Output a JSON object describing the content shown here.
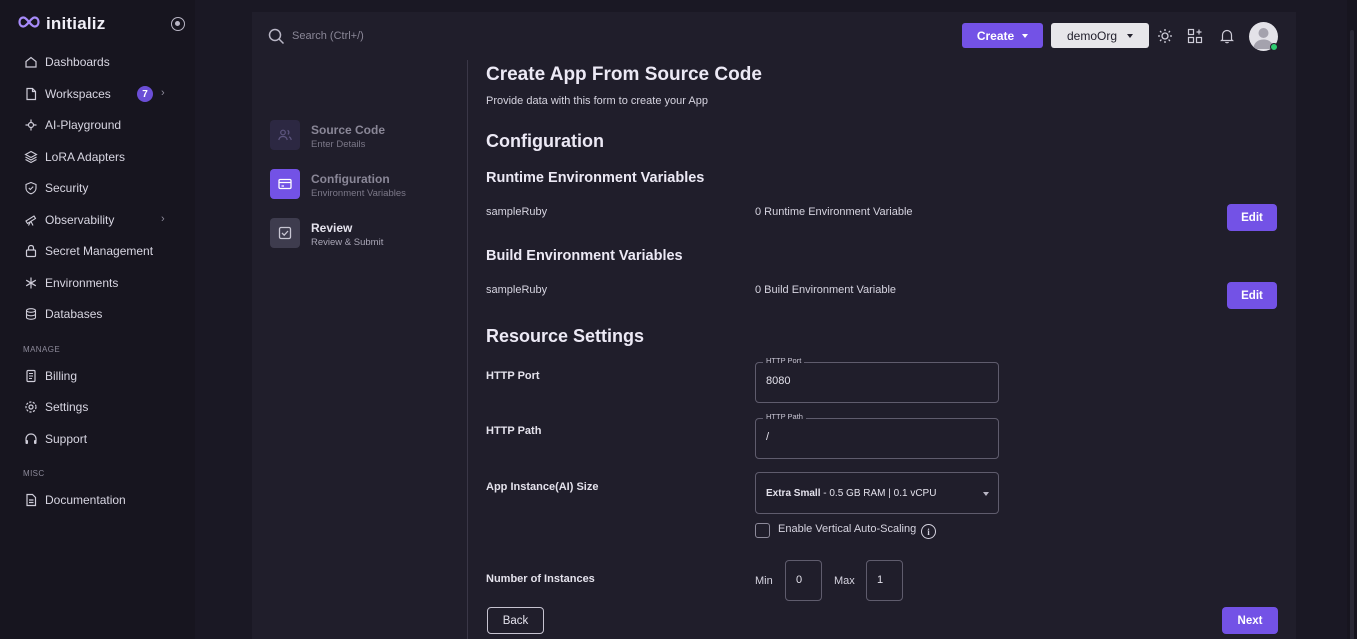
{
  "brand": {
    "name": "initializ"
  },
  "sidebar": {
    "items": [
      {
        "label": "Dashboards",
        "icon": "home-icon"
      },
      {
        "label": "Workspaces",
        "icon": "file-icon",
        "badge": "7"
      },
      {
        "label": "AI-Playground",
        "icon": "ai-icon"
      },
      {
        "label": "LoRA Adapters",
        "icon": "layers-icon"
      },
      {
        "label": "Security",
        "icon": "shield-icon"
      },
      {
        "label": "Observability",
        "icon": "telescope-icon"
      },
      {
        "label": "Secret Management",
        "icon": "lock-icon"
      },
      {
        "label": "Environments",
        "icon": "snowflake-icon"
      },
      {
        "label": "Databases",
        "icon": "database-icon"
      }
    ],
    "manage_label": "MANAGE",
    "manage_items": [
      {
        "label": "Billing",
        "icon": "receipt-icon"
      },
      {
        "label": "Settings",
        "icon": "gear-icon"
      },
      {
        "label": "Support",
        "icon": "headset-icon"
      }
    ],
    "misc_label": "MISC",
    "misc_items": [
      {
        "label": "Documentation",
        "icon": "document-icon"
      }
    ]
  },
  "header": {
    "search_placeholder": "Search (Ctrl+/)",
    "create_label": "Create",
    "org_label": "demoOrg"
  },
  "steps": [
    {
      "title": "Source Code",
      "subtitle": "Enter Details",
      "state": "done"
    },
    {
      "title": "Configuration",
      "subtitle": "Environment Variables",
      "state": "active"
    },
    {
      "title": "Review",
      "subtitle": "Review & Submit",
      "state": "pending"
    }
  ],
  "form": {
    "title": "Create App From Source Code",
    "subtitle": "Provide data with this form to create your App",
    "configuration_heading": "Configuration",
    "runtime": {
      "heading": "Runtime Environment Variables",
      "app_name": "sampleRuby",
      "count_text": "0 Runtime Environment Variable",
      "edit_label": "Edit"
    },
    "build": {
      "heading": "Build Environment Variables",
      "app_name": "sampleRuby",
      "count_text": "0 Build Environment Variable",
      "edit_label": "Edit"
    },
    "resource_heading": "Resource Settings",
    "http_port": {
      "label": "HTTP Port",
      "legend": "HTTP Port",
      "value": "8080"
    },
    "http_path": {
      "label": "HTTP Path",
      "legend": "HTTP Path",
      "value": "/"
    },
    "instance_size": {
      "label": "App Instance(AI) Size",
      "size_name": "Extra Small",
      "size_detail": " - 0.5 GB RAM | 0.1 vCPU"
    },
    "autoscaling_label": "Enable Vertical Auto-Scaling",
    "instances": {
      "label": "Number of Instances",
      "min_label": "Min",
      "min_value": "0",
      "max_label": "Max",
      "max_value": "1"
    },
    "back_label": "Back",
    "next_label": "Next"
  },
  "colors": {
    "accent": "#7352e6",
    "badge": "#6b4ed6",
    "online": "#2ecc71"
  }
}
